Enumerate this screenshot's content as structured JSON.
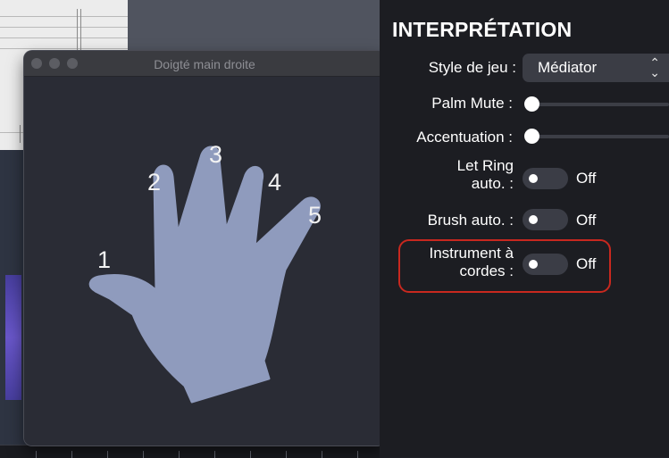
{
  "window": {
    "title": "Doigté main droite",
    "fingers": [
      "1",
      "2",
      "3",
      "4",
      "5"
    ]
  },
  "panel": {
    "title": "INTERPRÉTATION",
    "style_label": "Style de jeu :",
    "style_value": "Médiator",
    "palm_mute_label": "Palm Mute :",
    "accentuation_label": "Accentuation :",
    "let_ring_label_1": "Let Ring",
    "let_ring_label_2": "auto. :",
    "let_ring_state": "Off",
    "brush_label": "Brush auto. :",
    "brush_state": "Off",
    "instrument_label_1": "Instrument à",
    "instrument_label_2": "cordes :",
    "instrument_state": "Off"
  },
  "colors": {
    "hand": "#8f9bbd",
    "highlight": "#c8281f",
    "panel_bg": "#1c1d22"
  }
}
